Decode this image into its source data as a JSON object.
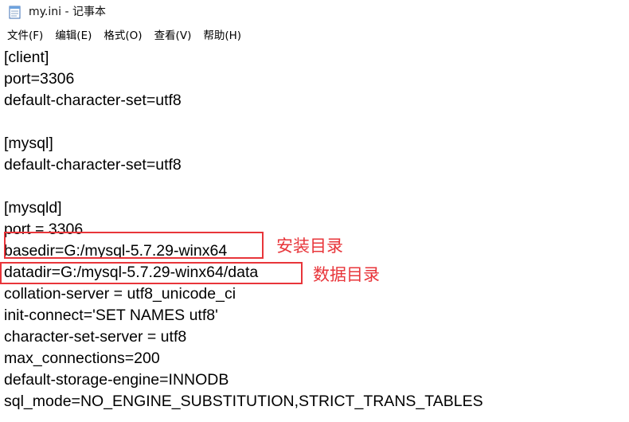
{
  "window": {
    "title": "my.ini - 记事本"
  },
  "menu": {
    "items": [
      "文件(F)",
      "编辑(E)",
      "格式(O)",
      "查看(V)",
      "帮助(H)"
    ]
  },
  "editor": {
    "lines": [
      "[client]",
      "port=3306",
      "default-character-set=utf8",
      "",
      "[mysql]",
      "default-character-set=utf8",
      "",
      "[mysqld]",
      "port = 3306",
      "basedir=G:/mysql-5.7.29-winx64",
      "datadir=G:/mysql-5.7.29-winx64/data",
      "collation-server = utf8_unicode_ci",
      "init-connect='SET NAMES utf8'",
      "character-set-server = utf8",
      "max_connections=200",
      "default-storage-engine=INNODB",
      "sql_mode=NO_ENGINE_SUBSTITUTION,STRICT_TRANS_TABLES"
    ]
  },
  "annotations": {
    "install_dir": "安装目录",
    "data_dir": "数据目录"
  },
  "colors": {
    "annotation": "#e8353a",
    "text": "#000000",
    "background": "#ffffff"
  }
}
